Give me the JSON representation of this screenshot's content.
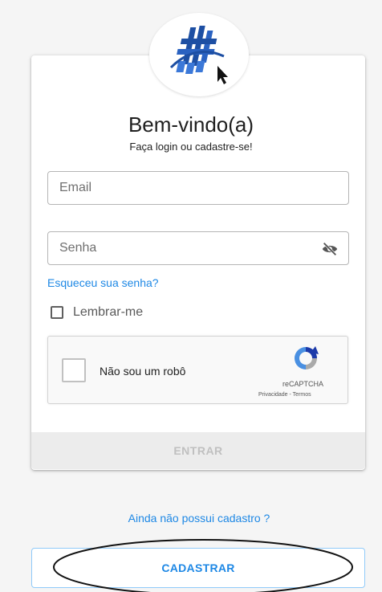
{
  "header": {
    "title": "Bem-vindo(a)",
    "subtitle": "Faça login ou cadastre-se!"
  },
  "form": {
    "email_placeholder": "Email",
    "password_placeholder": "Senha",
    "password_toggle_icon": "eye-off-icon",
    "forgot_password": "Esqueceu sua senha?",
    "remember_me": "Lembrar-me",
    "submit_label": "ENTRAR"
  },
  "captcha": {
    "label": "Não sou um robô",
    "brand": "reCAPTCHA",
    "links": "Privacidade - Termos"
  },
  "signup": {
    "prompt": "Ainda não possui cadastro ?",
    "button_label": "CADASTRAR"
  },
  "colors": {
    "accent": "#1e88e5",
    "logo_blue": "#1d4fa3",
    "disabled_bar": "#ececec"
  }
}
